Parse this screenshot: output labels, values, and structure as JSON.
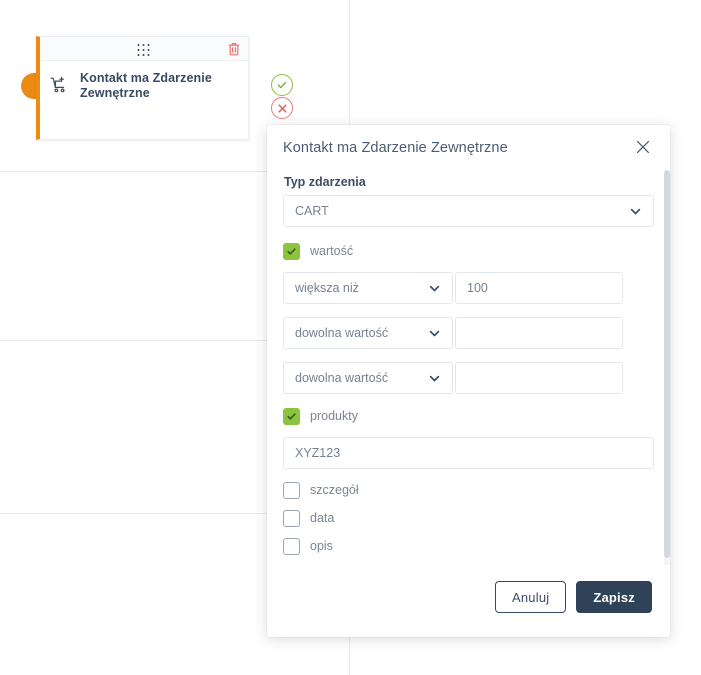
{
  "canvas": {
    "node": {
      "title": "Kontakt ma Zdarzenie Zewnętrzne",
      "icon": "cart-plus-icon",
      "drag_handle": "drag-handle-icon",
      "delete_icon": "trash-icon",
      "accent_color": "#ec8b14",
      "status_success_icon": "check-circle-icon",
      "status_failure_icon": "x-circle-icon",
      "status_success_color": "#8cbf3f",
      "status_failure_color": "#ef7b7b"
    }
  },
  "modal": {
    "title": "Kontakt ma Zdarzenie Zewnętrzne",
    "close_icon": "close-icon",
    "event_type": {
      "label": "Typ zdarzenia",
      "value": "CART",
      "caret_icon": "chevron-down-icon"
    },
    "value_section": {
      "checkbox_label": "wartość",
      "checked": true,
      "rows": [
        {
          "operator": "większa niż",
          "value": "100",
          "placeholder": ""
        },
        {
          "operator": "dowolna wartość",
          "value": "",
          "placeholder": ""
        },
        {
          "operator": "dowolna wartość",
          "value": "",
          "placeholder": ""
        }
      ]
    },
    "products_section": {
      "checkbox_label": "produkty",
      "checked": true,
      "input_value": "XYZ123"
    },
    "extra_checkboxes": [
      {
        "label": "szczegół",
        "checked": false
      },
      {
        "label": "data",
        "checked": false
      },
      {
        "label": "opis",
        "checked": false
      }
    ],
    "footer": {
      "cancel_label": "Anuluj",
      "save_label": "Zapisz"
    },
    "colors": {
      "checkbox_on": "#8bc53f",
      "primary_button": "#2f4257"
    }
  }
}
